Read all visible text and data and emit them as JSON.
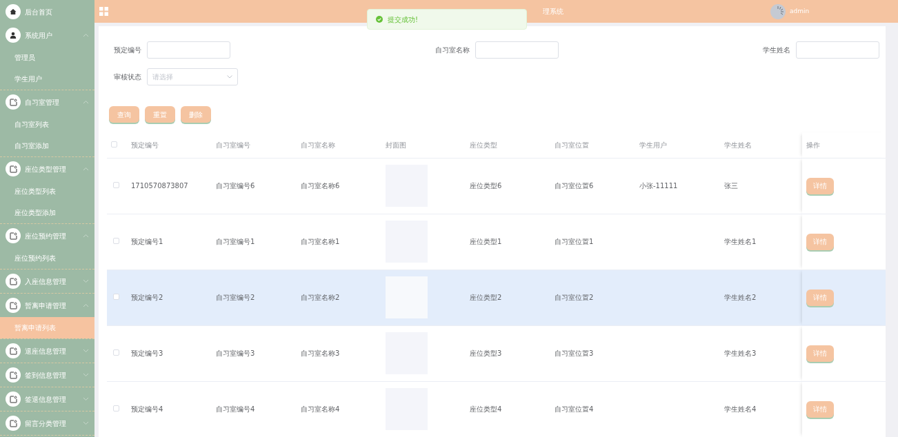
{
  "header": {
    "title": "理系统",
    "user": "admin"
  },
  "toast": {
    "message": "提交成功!"
  },
  "sidebar": {
    "items": [
      {
        "label": "后台首页",
        "kind": "home"
      },
      {
        "label": "系统用户",
        "kind": "user",
        "expanded": true,
        "children": [
          {
            "label": "管理员",
            "selected": false
          },
          {
            "label": "学生用户",
            "selected": false
          }
        ]
      },
      {
        "label": "自习室管理",
        "kind": "group",
        "expanded": true,
        "children": [
          {
            "label": "自习室列表",
            "selected": false
          },
          {
            "label": "自习室添加",
            "selected": false
          }
        ]
      },
      {
        "label": "座位类型管理",
        "kind": "group",
        "expanded": true,
        "children": [
          {
            "label": "座位类型列表",
            "selected": false
          },
          {
            "label": "座位类型添加",
            "selected": false
          }
        ]
      },
      {
        "label": "座位预约管理",
        "kind": "group",
        "expanded": true,
        "children": [
          {
            "label": "座位预约列表",
            "selected": false
          }
        ]
      },
      {
        "label": "入座信息管理",
        "kind": "group",
        "expanded": false
      },
      {
        "label": "暂离申请管理",
        "kind": "group",
        "expanded": true,
        "children": [
          {
            "label": "暂离申请列表",
            "selected": true
          }
        ]
      },
      {
        "label": "退座信息管理",
        "kind": "group",
        "expanded": false
      },
      {
        "label": "签到信息管理",
        "kind": "group",
        "expanded": false
      },
      {
        "label": "签退信息管理",
        "kind": "group",
        "expanded": false
      },
      {
        "label": "留言分类管理",
        "kind": "group",
        "expanded": false
      }
    ]
  },
  "filters": [
    {
      "label": "预定编号",
      "kind": "text"
    },
    {
      "label": "自习室名称",
      "kind": "text"
    },
    {
      "label": "学生姓名",
      "kind": "text"
    },
    {
      "label": "审核状态",
      "kind": "select",
      "placeholder": "请选择"
    }
  ],
  "buttons": [
    "查询",
    "重置",
    "删除"
  ],
  "table": {
    "select_all": {
      "checked": false
    },
    "columns": [
      "预定编号",
      "自习室编号",
      "自习室名称",
      "封面图",
      "座位类型",
      "自习室位置",
      "学生用户",
      "学生姓名",
      "操作"
    ],
    "rows": [
      {
        "checked": false,
        "selected": false,
        "cells": [
          "1710570873807",
          "自习室编号6",
          "自习室名称6",
          "",
          "座位类型6",
          "自习室位置6",
          "小张-11111",
          "张三"
        ],
        "action": "详情"
      },
      {
        "checked": false,
        "selected": false,
        "cells": [
          "预定编号1",
          "自习室编号1",
          "自习室名称1",
          "",
          "座位类型1",
          "自习室位置1",
          "",
          "学生姓名1"
        ],
        "action": "详情"
      },
      {
        "checked": false,
        "selected": true,
        "cells": [
          "预定编号2",
          "自习室编号2",
          "自习室名称2",
          "",
          "座位类型2",
          "自习室位置2",
          "",
          "学生姓名2"
        ],
        "action": "详情"
      },
      {
        "checked": false,
        "selected": false,
        "cells": [
          "预定编号3",
          "自习室编号3",
          "自习室名称3",
          "",
          "座位类型3",
          "自习室位置3",
          "",
          "学生姓名3"
        ],
        "action": "详情"
      },
      {
        "checked": false,
        "selected": false,
        "cells": [
          "预定编号4",
          "自习室编号4",
          "自习室名称4",
          "",
          "座位类型4",
          "自习室位置4",
          "",
          "学生姓名4"
        ],
        "action": "详情"
      }
    ]
  }
}
